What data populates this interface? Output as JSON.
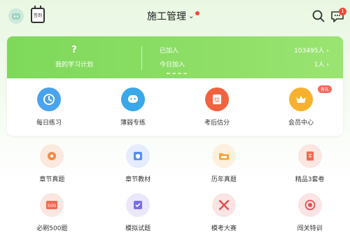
{
  "header": {
    "title": "施工管理",
    "checkin_label": "签到",
    "message_count": "1"
  },
  "banner": {
    "plan_symbol": "?",
    "plan_label": "我的学习计划",
    "stats": [
      {
        "label": "已加入",
        "value": "103495人 ›"
      },
      {
        "label": "今日加入",
        "value": "1人 ›"
      }
    ]
  },
  "quick_actions": [
    {
      "label": "每日练习",
      "icon": "clock-icon",
      "color": "#4aa3ee"
    },
    {
      "label": "薄弱专练",
      "icon": "chat-face-icon",
      "color": "#39a7ea"
    },
    {
      "label": "考后估分",
      "icon": "score-icon",
      "color": "#f1623f"
    },
    {
      "label": "会员中心",
      "icon": "crown-icon",
      "color": "#f7b12e",
      "tag": "有礼"
    }
  ],
  "grid": [
    {
      "label": "章节真题",
      "icon": "gear-icon",
      "color": "#fbe9df"
    },
    {
      "label": "章节教材",
      "icon": "book-shield-icon",
      "color": "#e5ecfb"
    },
    {
      "label": "历年真题",
      "icon": "folder-icon",
      "color": "#fdf0df"
    },
    {
      "label": "精品3套卷",
      "icon": "document-icon",
      "color": "#fce6e1"
    },
    {
      "label": "必刷500题",
      "icon": "score-500-icon",
      "color": "#fce6e1"
    },
    {
      "label": "模拟试题",
      "icon": "checklist-icon",
      "color": "#ebe7fb"
    },
    {
      "label": "模考大赛",
      "icon": "swords-icon",
      "color": "#fbe4e4"
    },
    {
      "label": "闯关特训",
      "icon": "target-icon",
      "color": "#fbe4e4"
    }
  ]
}
